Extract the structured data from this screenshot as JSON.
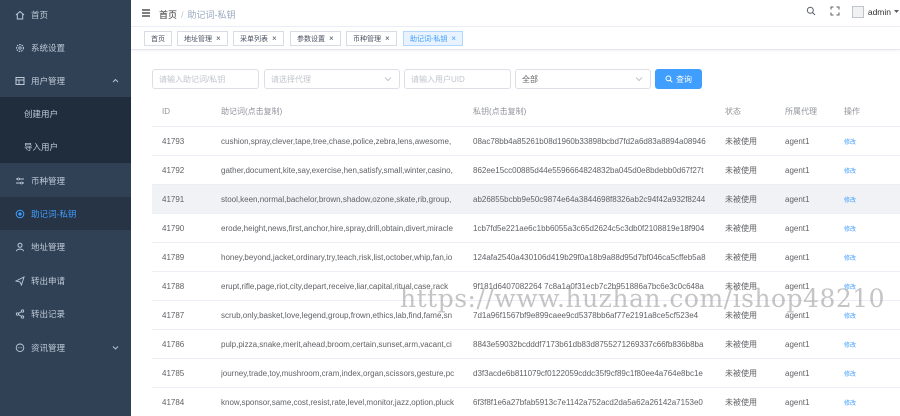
{
  "sidebar": {
    "items": [
      {
        "label": "首页",
        "icon": "home-icon"
      },
      {
        "label": "系统设置",
        "icon": "gear-icon"
      },
      {
        "label": "用户管理",
        "icon": "user-grid-icon"
      },
      {
        "label": "创建用户"
      },
      {
        "label": "导入用户"
      },
      {
        "label": "币种管理",
        "icon": "sliders-icon"
      },
      {
        "label": "助记词-私钥",
        "icon": "dot-circle-icon"
      },
      {
        "label": "地址管理",
        "icon": "person-icon"
      },
      {
        "label": "转出申请",
        "icon": "send-icon"
      },
      {
        "label": "转出记录",
        "icon": "share-icon"
      },
      {
        "label": "资讯管理",
        "icon": "chat-icon"
      }
    ]
  },
  "header": {
    "breadcrumb_home": "首页",
    "breadcrumb_current": "助记词-私钥",
    "user": "admin"
  },
  "tabs": [
    {
      "label": "首页"
    },
    {
      "label": "地址管理"
    },
    {
      "label": "采单列表"
    },
    {
      "label": "参数设置"
    },
    {
      "label": "币种管理"
    },
    {
      "label": "助记词-私钥"
    }
  ],
  "filters": {
    "mnemonic_placeholder": "请输入助记词/私钥",
    "agent_placeholder": "请选择代理",
    "uid_placeholder": "请输入用户UID",
    "status_value": "全部",
    "search_label": "查询"
  },
  "table": {
    "headers": [
      "ID",
      "助记词(点击复制)",
      "私钥(点击复制)",
      "状态",
      "所属代理",
      "操作"
    ],
    "rows": [
      {
        "id": "41793",
        "mnemonic": "cushion,spray,clever,tape,tree,chase,police,zebra,lens,awesome,",
        "key": "08ac78bb4a85261b08d1960b33898bcbd7fd2a6d83a8894a08946",
        "status": "未被使用",
        "agent": "agent1",
        "op": "修改"
      },
      {
        "id": "41792",
        "mnemonic": "gather,document,kite,say,exercise,hen,satisfy,small,winter,casino,",
        "key": "862ee15cc00885d44e5596664824832ba045d0e8bdebb0d67f27t",
        "status": "未被使用",
        "agent": "agent1",
        "op": "修改"
      },
      {
        "id": "41791",
        "mnemonic": "stool,keen,normal,bachelor,brown,shadow,ozone,skate,rib,group,",
        "key": "ab26855bcbb9e50c9874e64a3844698f8326ab2c94f42a932f8244",
        "status": "未被使用",
        "agent": "agent1",
        "op": "修改"
      },
      {
        "id": "41790",
        "mnemonic": "erode,height,news,first,anchor,hire,spray,drill,obtain,divert,miracle",
        "key": "1cb7fd5e221ae6c1bb6055a3c65d2624c5c3db0f2108819e18f904",
        "status": "未被使用",
        "agent": "agent1",
        "op": "修改"
      },
      {
        "id": "41789",
        "mnemonic": "honey,beyond,jacket,ordinary,try,teach,risk,list,october,whip,fan,io",
        "key": "124afa2540a430106d419b29f0a18b9a88d95d7bf046ca5cffeb5a8",
        "status": "未被使用",
        "agent": "agent1",
        "op": "修改"
      },
      {
        "id": "41788",
        "mnemonic": "erupt,rifle,page,riot,city,depart,receive,liar,capital,ritual,case,rack",
        "key": "9f181d6407082264 7c8a1a0f31ecb7c2b951886a7bc6e3c0c648a",
        "status": "未被使用",
        "agent": "agent1",
        "op": "修改"
      },
      {
        "id": "41787",
        "mnemonic": "scrub,only,basket,love,legend,group,frown,ethics,lab,find,fame,sn",
        "key": "7d1a96f1567bf9e899caee9cd5378bb6af77e2191a8ce5cf523e4",
        "status": "未被使用",
        "agent": "agent1",
        "op": "修改"
      },
      {
        "id": "41786",
        "mnemonic": "pulp,pizza,snake,merit,ahead,broom,certain,sunset,arm,vacant,ci",
        "key": "8843e59032bcdddf7173b61db83d8755271269337c66fb836b8ba",
        "status": "未被使用",
        "agent": "agent1",
        "op": "修改"
      },
      {
        "id": "41785",
        "mnemonic": "journey,trade,toy,mushroom,cram,index,organ,scissors,gesture,pc",
        "key": "d3f3acde6b811079cf0122059cddc35f9cf89c1f80ee4a764e8bc1e",
        "status": "未被使用",
        "agent": "agent1",
        "op": "修改"
      },
      {
        "id": "41784",
        "mnemonic": "know,sponsor,same,cost,resist,rate,level,monitor,jazz,option,pluck",
        "key": "6f3f8f1e6a27bfab5913c7e1142a752acd2da5a62a26142a7153e0",
        "status": "未被使用",
        "agent": "agent1",
        "op": "修改"
      }
    ]
  },
  "watermark": "https://www.huzhan.com/ishop48210",
  "colors": {
    "sidebar": "#304156",
    "active": "#409eff"
  }
}
